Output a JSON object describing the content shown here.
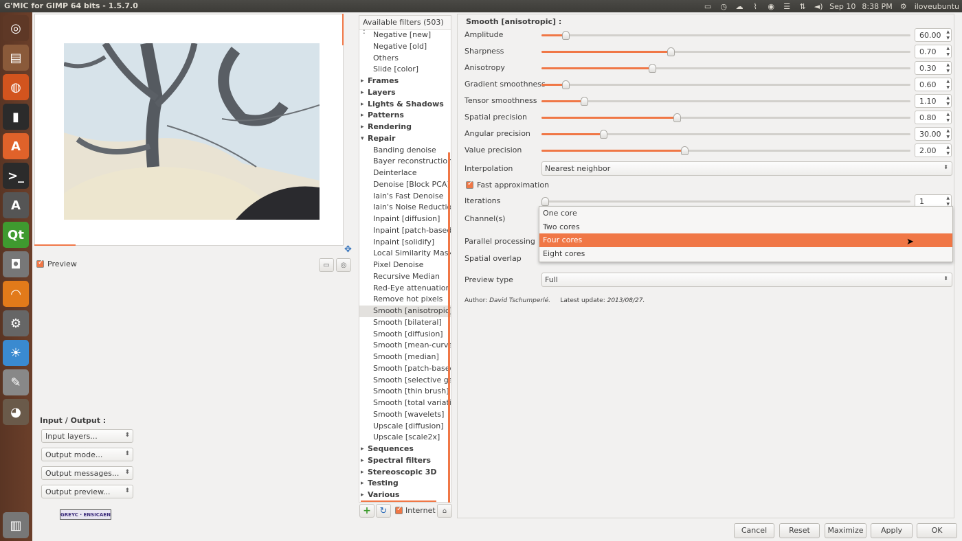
{
  "window_title": "G'MIC for GIMP 64 bits - 1.5.7.0",
  "tray": {
    "date": "Sep 10",
    "time": "8:38 PM",
    "user": "iloveubuntu"
  },
  "launcher": [
    {
      "name": "ubuntu-dash-icon"
    },
    {
      "name": "files-icon"
    },
    {
      "name": "firefox-icon"
    },
    {
      "name": "terminal-icon"
    },
    {
      "name": "software-center-icon"
    },
    {
      "name": "terminal2-icon"
    },
    {
      "name": "update-manager-icon"
    },
    {
      "name": "qt-creator-icon"
    },
    {
      "name": "camera-icon"
    },
    {
      "name": "rss-icon"
    },
    {
      "name": "settings-icon"
    },
    {
      "name": "weather-icon"
    },
    {
      "name": "text-editor-icon"
    },
    {
      "name": "gimp-icon"
    },
    {
      "name": "trash-icon"
    }
  ],
  "preview": {
    "label": "Preview"
  },
  "io": {
    "title": "Input / Output :",
    "selects": [
      "Input layers...",
      "Output mode...",
      "Output messages...",
      "Output preview..."
    ]
  },
  "filters": {
    "header": "Available filters (503) :",
    "nodes": [
      {
        "t": "leaf",
        "label": "Negative [new]"
      },
      {
        "t": "leaf",
        "label": "Negative [old]"
      },
      {
        "t": "leaf",
        "label": "Others"
      },
      {
        "t": "leaf",
        "label": "Slide [color]"
      },
      {
        "t": "cat",
        "label": "Frames"
      },
      {
        "t": "cat",
        "label": "Layers"
      },
      {
        "t": "cat",
        "label": "Lights & Shadows"
      },
      {
        "t": "cat",
        "label": "Patterns"
      },
      {
        "t": "cat",
        "label": "Rendering"
      },
      {
        "t": "cat-open",
        "label": "Repair"
      },
      {
        "t": "leaf",
        "label": "Banding denoise"
      },
      {
        "t": "leaf",
        "label": "Bayer reconstruction"
      },
      {
        "t": "leaf",
        "label": "Deinterlace"
      },
      {
        "t": "leaf",
        "label": "Denoise [Block PCA]"
      },
      {
        "t": "leaf",
        "label": "Iain's Fast Denoise"
      },
      {
        "t": "leaf",
        "label": "Iain's Noise Reduction"
      },
      {
        "t": "leaf",
        "label": "Inpaint [diffusion]"
      },
      {
        "t": "leaf",
        "label": "Inpaint [patch-based]"
      },
      {
        "t": "leaf",
        "label": "Inpaint [solidify]"
      },
      {
        "t": "leaf",
        "label": "Local Similarity Mask"
      },
      {
        "t": "leaf",
        "label": "Pixel Denoise"
      },
      {
        "t": "leaf",
        "label": "Recursive Median"
      },
      {
        "t": "leaf",
        "label": "Red-Eye attenuation"
      },
      {
        "t": "leaf",
        "label": "Remove hot pixels"
      },
      {
        "t": "leaf-sel",
        "label": "Smooth [anisotropic]"
      },
      {
        "t": "leaf",
        "label": "Smooth [bilateral]"
      },
      {
        "t": "leaf",
        "label": "Smooth [diffusion]"
      },
      {
        "t": "leaf",
        "label": "Smooth [mean-curvatu"
      },
      {
        "t": "leaf",
        "label": "Smooth [median]"
      },
      {
        "t": "leaf",
        "label": "Smooth [patch-based]"
      },
      {
        "t": "leaf",
        "label": "Smooth [selective gaus"
      },
      {
        "t": "leaf",
        "label": "Smooth [thin brush]"
      },
      {
        "t": "leaf",
        "label": "Smooth [total variatior"
      },
      {
        "t": "leaf",
        "label": "Smooth [wavelets]"
      },
      {
        "t": "leaf",
        "label": "Upscale [diffusion]"
      },
      {
        "t": "leaf",
        "label": "Upscale [scale2x]"
      },
      {
        "t": "cat",
        "label": "Sequences"
      },
      {
        "t": "cat",
        "label": "Spectral filters"
      },
      {
        "t": "cat",
        "label": "Stereoscopic 3D"
      },
      {
        "t": "cat",
        "label": "Testing"
      },
      {
        "t": "cat",
        "label": "Various"
      }
    ],
    "internet_label": "Internet"
  },
  "params": {
    "title": "Smooth [anisotropic] :",
    "sliders": [
      {
        "label": "Amplitude",
        "value": "60.00",
        "level": 0.065
      },
      {
        "label": "Sharpness",
        "value": "0.70",
        "level": 0.35
      },
      {
        "label": "Anisotropy",
        "value": "0.30",
        "level": 0.3
      },
      {
        "label": "Gradient smoothness",
        "value": "0.60",
        "level": 0.065
      },
      {
        "label": "Tensor smoothness",
        "value": "1.10",
        "level": 0.115
      },
      {
        "label": "Spatial precision",
        "value": "0.80",
        "level": 0.367
      },
      {
        "label": "Angular precision",
        "value": "30.00",
        "level": 0.167
      },
      {
        "label": "Value precision",
        "value": "2.00",
        "level": 0.387
      }
    ],
    "interpolation_label": "Interpolation",
    "interpolation_value": "Nearest neighbor",
    "fast_approx_label": "Fast approximation",
    "iterations_label": "Iterations",
    "iterations_value": "1",
    "iterations_level": 0.0,
    "channels_label": "Channel(s)",
    "parallel_label": "Parallel processing",
    "overlap_label": "Spatial overlap",
    "preview_type_label": "Preview type",
    "preview_type_value": "Full",
    "dropdown_options": [
      "One core",
      "Two cores",
      "Four cores",
      "Eight cores"
    ],
    "dropdown_highlight": "Four cores",
    "author_label": "Author:",
    "author_name": "David Tschumperlé.",
    "update_label": "Latest update:",
    "update_date": "2013/08/27."
  },
  "buttons": {
    "cancel": "Cancel",
    "reset": "Reset",
    "maximize": "Maximize",
    "apply": "Apply",
    "ok": "OK"
  },
  "colors": {
    "accent": "#f07746",
    "launcher": "#5e3826",
    "panel": "#3c3b37"
  }
}
